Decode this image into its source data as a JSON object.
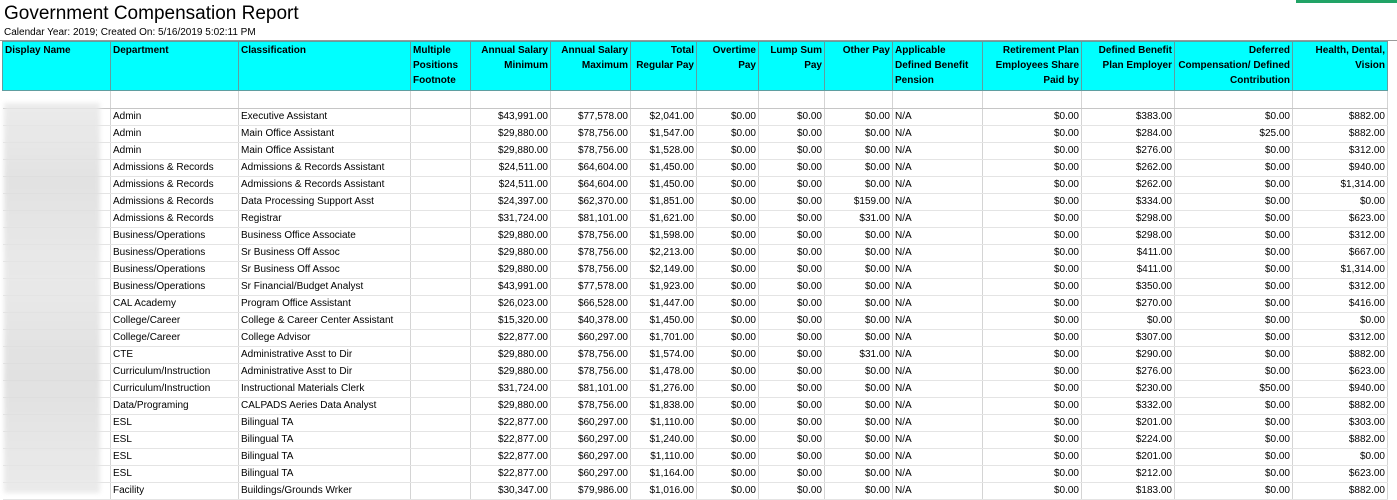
{
  "title": "Government Compensation Report",
  "subtitle": "Calendar Year: 2019; Created On: 5/16/2019 5:02:11 PM",
  "headers": [
    "Display Name",
    "Department",
    "Classification",
    "Multiple Positions Footnote",
    "Annual Salary Minimum",
    "Annual Salary Maximum",
    "Total Regular Pay",
    "Overtime Pay",
    "Lump Sum Pay",
    "Other Pay",
    "Applicable Defined Benefit Pension",
    "Retirement Plan Employees Share Paid by",
    "Defined Benefit Plan Employer",
    "Deferred Compensation/ Defined Contribution",
    "Health, Dental, Vision"
  ],
  "rows": [
    [
      "",
      "Admin",
      "Executive Assistant",
      "",
      "$43,991.00",
      "$77,578.00",
      "$2,041.00",
      "$0.00",
      "$0.00",
      "$0.00",
      "N/A",
      "$0.00",
      "$383.00",
      "$0.00",
      "$882.00"
    ],
    [
      "",
      "Admin",
      "Main Office Assistant",
      "",
      "$29,880.00",
      "$78,756.00",
      "$1,547.00",
      "$0.00",
      "$0.00",
      "$0.00",
      "N/A",
      "$0.00",
      "$284.00",
      "$25.00",
      "$882.00"
    ],
    [
      "",
      "Admin",
      "Main Office Assistant",
      "",
      "$29,880.00",
      "$78,756.00",
      "$1,528.00",
      "$0.00",
      "$0.00",
      "$0.00",
      "N/A",
      "$0.00",
      "$276.00",
      "$0.00",
      "$312.00"
    ],
    [
      "",
      "Admissions & Records",
      "Admissions & Records Assistant",
      "",
      "$24,511.00",
      "$64,604.00",
      "$1,450.00",
      "$0.00",
      "$0.00",
      "$0.00",
      "N/A",
      "$0.00",
      "$262.00",
      "$0.00",
      "$940.00"
    ],
    [
      "",
      "Admissions & Records",
      "Admissions & Records Assistant",
      "",
      "$24,511.00",
      "$64,604.00",
      "$1,450.00",
      "$0.00",
      "$0.00",
      "$0.00",
      "N/A",
      "$0.00",
      "$262.00",
      "$0.00",
      "$1,314.00"
    ],
    [
      "",
      "Admissions & Records",
      "Data Processing Support Asst",
      "",
      "$24,397.00",
      "$62,370.00",
      "$1,851.00",
      "$0.00",
      "$0.00",
      "$159.00",
      "N/A",
      "$0.00",
      "$334.00",
      "$0.00",
      "$0.00"
    ],
    [
      "",
      "Admissions & Records",
      "Registrar",
      "",
      "$31,724.00",
      "$81,101.00",
      "$1,621.00",
      "$0.00",
      "$0.00",
      "$31.00",
      "N/A",
      "$0.00",
      "$298.00",
      "$0.00",
      "$623.00"
    ],
    [
      "",
      "Business/Operations",
      "Business Office Associate",
      "",
      "$29,880.00",
      "$78,756.00",
      "$1,598.00",
      "$0.00",
      "$0.00",
      "$0.00",
      "N/A",
      "$0.00",
      "$298.00",
      "$0.00",
      "$312.00"
    ],
    [
      "",
      "Business/Operations",
      "Sr Business Off Assoc",
      "",
      "$29,880.00",
      "$78,756.00",
      "$2,213.00",
      "$0.00",
      "$0.00",
      "$0.00",
      "N/A",
      "$0.00",
      "$411.00",
      "$0.00",
      "$667.00"
    ],
    [
      "",
      "Business/Operations",
      "Sr Business Off Assoc",
      "",
      "$29,880.00",
      "$78,756.00",
      "$2,149.00",
      "$0.00",
      "$0.00",
      "$0.00",
      "N/A",
      "$0.00",
      "$411.00",
      "$0.00",
      "$1,314.00"
    ],
    [
      "",
      "Business/Operations",
      "Sr Financial/Budget Analyst",
      "",
      "$43,991.00",
      "$77,578.00",
      "$1,923.00",
      "$0.00",
      "$0.00",
      "$0.00",
      "N/A",
      "$0.00",
      "$350.00",
      "$0.00",
      "$312.00"
    ],
    [
      "",
      "CAL Academy",
      "Program Office Assistant",
      "",
      "$26,023.00",
      "$66,528.00",
      "$1,447.00",
      "$0.00",
      "$0.00",
      "$0.00",
      "N/A",
      "$0.00",
      "$270.00",
      "$0.00",
      "$416.00"
    ],
    [
      "",
      "College/Career",
      "College & Career Center Assistant",
      "",
      "$15,320.00",
      "$40,378.00",
      "$1,450.00",
      "$0.00",
      "$0.00",
      "$0.00",
      "N/A",
      "$0.00",
      "$0.00",
      "$0.00",
      "$0.00"
    ],
    [
      "",
      "College/Career",
      "College Advisor",
      "",
      "$22,877.00",
      "$60,297.00",
      "$1,701.00",
      "$0.00",
      "$0.00",
      "$0.00",
      "N/A",
      "$0.00",
      "$307.00",
      "$0.00",
      "$312.00"
    ],
    [
      "",
      "CTE",
      "Administrative Asst to Dir",
      "",
      "$29,880.00",
      "$78,756.00",
      "$1,574.00",
      "$0.00",
      "$0.00",
      "$31.00",
      "N/A",
      "$0.00",
      "$290.00",
      "$0.00",
      "$882.00"
    ],
    [
      "",
      "Curriculum/Instruction",
      "Administrative Asst to Dir",
      "",
      "$29,880.00",
      "$78,756.00",
      "$1,478.00",
      "$0.00",
      "$0.00",
      "$0.00",
      "N/A",
      "$0.00",
      "$276.00",
      "$0.00",
      "$623.00"
    ],
    [
      "",
      "Curriculum/Instruction",
      "Instructional Materials Clerk",
      "",
      "$31,724.00",
      "$81,101.00",
      "$1,276.00",
      "$0.00",
      "$0.00",
      "$0.00",
      "N/A",
      "$0.00",
      "$230.00",
      "$50.00",
      "$940.00"
    ],
    [
      "",
      "Data/Programing",
      "CALPADS Aeries Data Analyst",
      "",
      "$29,880.00",
      "$78,756.00",
      "$1,838.00",
      "$0.00",
      "$0.00",
      "$0.00",
      "N/A",
      "$0.00",
      "$332.00",
      "$0.00",
      "$882.00"
    ],
    [
      "",
      "ESL",
      "Bilingual TA",
      "",
      "$22,877.00",
      "$60,297.00",
      "$1,110.00",
      "$0.00",
      "$0.00",
      "$0.00",
      "N/A",
      "$0.00",
      "$201.00",
      "$0.00",
      "$303.00"
    ],
    [
      "",
      "ESL",
      "Bilingual TA",
      "",
      "$22,877.00",
      "$60,297.00",
      "$1,240.00",
      "$0.00",
      "$0.00",
      "$0.00",
      "N/A",
      "$0.00",
      "$224.00",
      "$0.00",
      "$882.00"
    ],
    [
      "",
      "ESL",
      "Bilingual TA",
      "",
      "$22,877.00",
      "$60,297.00",
      "$1,110.00",
      "$0.00",
      "$0.00",
      "$0.00",
      "N/A",
      "$0.00",
      "$201.00",
      "$0.00",
      "$0.00"
    ],
    [
      "",
      "ESL",
      "Bilingual TA",
      "",
      "$22,877.00",
      "$60,297.00",
      "$1,164.00",
      "$0.00",
      "$0.00",
      "$0.00",
      "N/A",
      "$0.00",
      "$212.00",
      "$0.00",
      "$623.00"
    ],
    [
      "",
      "Facility",
      "Buildings/Grounds Wrker",
      "",
      "$30,347.00",
      "$79,986.00",
      "$1,016.00",
      "$0.00",
      "$0.00",
      "$0.00",
      "N/A",
      "$0.00",
      "$183.00",
      "$0.00",
      "$882.00"
    ]
  ]
}
